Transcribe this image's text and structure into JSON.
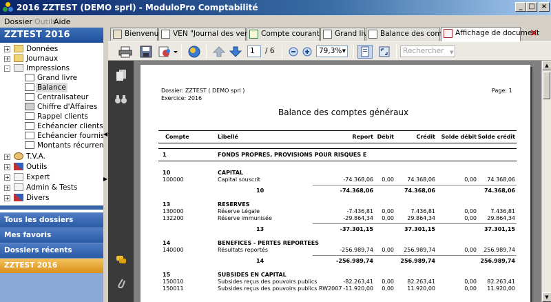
{
  "window": {
    "title": "2016 ZZTEST (DEMO sprl) - ModuloPro Comptabilité",
    "minimize": "_",
    "maximize": "□",
    "close": "×"
  },
  "menu": [
    "Dossier",
    "Outils",
    "Aide"
  ],
  "sidebar": {
    "title": "ZZTEST 2016",
    "tree": [
      {
        "label": "Données",
        "level": 0,
        "expander": "+"
      },
      {
        "label": "Journaux",
        "level": 0,
        "expander": "+"
      },
      {
        "label": "Impressions",
        "level": 0,
        "expander": "-"
      },
      {
        "label": "Grand livre",
        "level": 1
      },
      {
        "label": "Balance",
        "level": 1,
        "selected": true
      },
      {
        "label": "Centralisateur",
        "level": 1
      },
      {
        "label": "Chiffre d'Affaires",
        "level": 1
      },
      {
        "label": "Rappel clients",
        "level": 1
      },
      {
        "label": "Echéancier clients",
        "level": 1
      },
      {
        "label": "Echéancier fournisseurs",
        "level": 1
      },
      {
        "label": "Montants récurrents",
        "level": 1
      },
      {
        "label": "T.V.A.",
        "level": 0,
        "expander": "+"
      },
      {
        "label": "Outils",
        "level": 0,
        "expander": "+"
      },
      {
        "label": "Expert",
        "level": 0,
        "expander": "+"
      },
      {
        "label": "Admin & Tests",
        "level": 0,
        "expander": "+"
      },
      {
        "label": "Divers",
        "level": 0,
        "expander": "+"
      }
    ],
    "nav": [
      "Tous les dossiers",
      "Mes favoris",
      "Dossiers récents",
      "ZZTEST 2016"
    ]
  },
  "tabs": [
    "Bienvenue",
    "VEN \"Journal des ventes\"",
    "Compte courant TVA",
    "Grand livre",
    "Balance des comptes",
    "Affichage de document"
  ],
  "tab_close": "×",
  "toolbar": {
    "page_current": "1",
    "page_total": "/ 6",
    "zoom": "79,3%",
    "search_placeholder": "Rechercher"
  },
  "report": {
    "dossier": "Dossier: ZZTEST ( DEMO sprl )",
    "exercice": "Exercice: 2016",
    "page": "Page: 1",
    "title": "Balance des comptes généraux",
    "headers": [
      "Compte",
      "Libellé",
      "Report",
      "Débit",
      "Crédit",
      "Solde débit",
      "Solde crédit"
    ],
    "class_row": {
      "code": "1",
      "label": "FONDS PROPRES, PROVISIONS POUR RISQUES E"
    },
    "groups": [
      {
        "code": "10",
        "label": "CAPITAL",
        "rows": [
          {
            "compte": "100000",
            "libelle": "Capital souscrit",
            "report": "-74.368,06",
            "debit": "0,00",
            "credit": "74.368,06",
            "sd": "0,00",
            "sc": "74.368,06"
          }
        ],
        "total": {
          "code": "10",
          "report": "-74.368,06",
          "credit": "74.368,06",
          "sc": "74.368,06"
        }
      },
      {
        "code": "13",
        "label": "RESERVES",
        "rows": [
          {
            "compte": "130000",
            "libelle": "Réserve Légale",
            "report": "-7.436,81",
            "debit": "0,00",
            "credit": "7.436,81",
            "sd": "0,00",
            "sc": "7.436,81"
          },
          {
            "compte": "132200",
            "libelle": "Réserve immunisée",
            "report": "-29.864,34",
            "debit": "0,00",
            "credit": "29.864,34",
            "sd": "0,00",
            "sc": "29.864,34"
          }
        ],
        "total": {
          "code": "13",
          "report": "-37.301,15",
          "credit": "37.301,15",
          "sc": "37.301,15"
        }
      },
      {
        "code": "14",
        "label": "BENEFICES - PERTES REPORTEES",
        "rows": [
          {
            "compte": "140000",
            "libelle": "Résultats reportés",
            "report": "-256.989,74",
            "debit": "0,00",
            "credit": "256.989,74",
            "sd": "0,00",
            "sc": "256.989,74"
          }
        ],
        "total": {
          "code": "14",
          "report": "-256.989,74",
          "credit": "256.989,74",
          "sc": "256.989,74"
        }
      },
      {
        "code": "15",
        "label": "SUBSIDES EN CAPITAL",
        "rows": [
          {
            "compte": "150010",
            "libelle": "Subsides reçus des pouvoirs publics",
            "report": "-82.263,41",
            "debit": "0,00",
            "credit": "82.263,41",
            "sd": "0,00",
            "sc": "82.263,41"
          },
          {
            "compte": "150011",
            "libelle": "Subsides reçus des pouvoirs publics RW2007",
            "report": "-11.920,00",
            "debit": "0,00",
            "credit": "11.920,00",
            "sd": "0,00",
            "sc": "11.920,00"
          }
        ]
      }
    ]
  }
}
